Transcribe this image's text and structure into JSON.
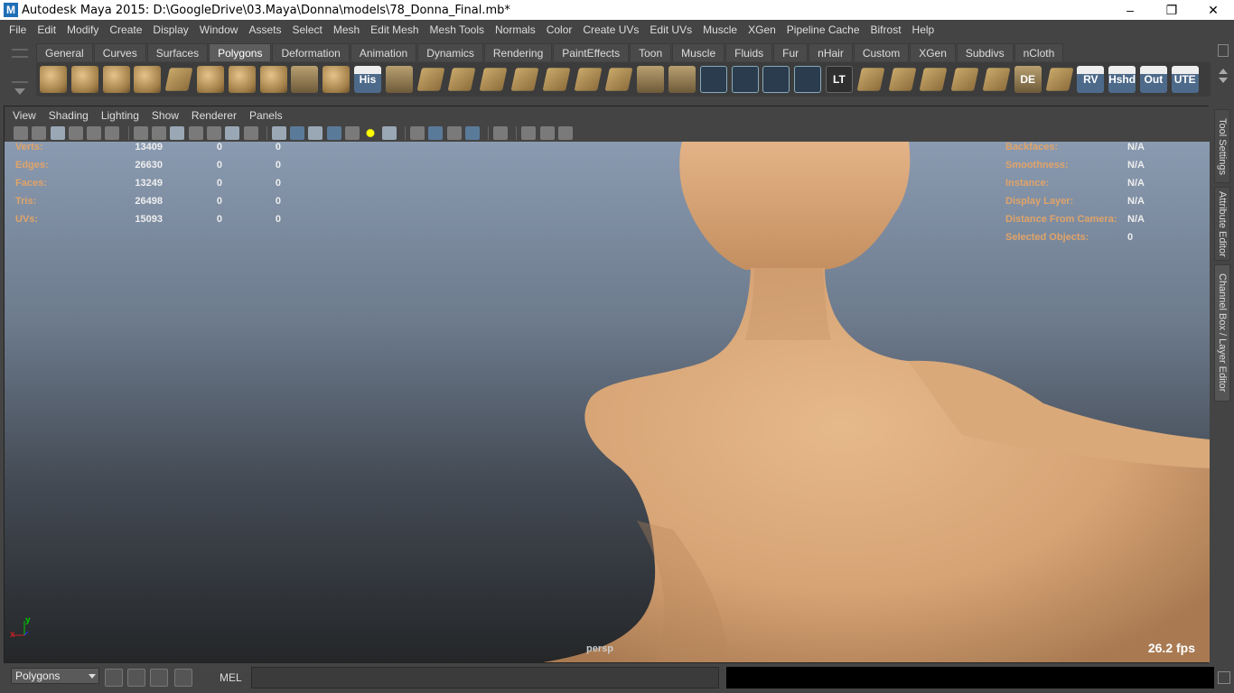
{
  "window": {
    "title": "Autodesk Maya 2015: D:\\GoogleDrive\\03.Maya\\Donna\\models\\78_Donna_Final.mb*",
    "app_icon": "M",
    "minimize": "–",
    "restore": "❐",
    "close": "✕"
  },
  "menubar": [
    "File",
    "Edit",
    "Modify",
    "Create",
    "Display",
    "Window",
    "Assets",
    "Select",
    "Mesh",
    "Edit Mesh",
    "Mesh Tools",
    "Normals",
    "Color",
    "Create UVs",
    "Edit UVs",
    "Muscle",
    "XGen",
    "Pipeline Cache",
    "Bifrost",
    "Help"
  ],
  "shelf": {
    "tabs": [
      "General",
      "Curves",
      "Surfaces",
      "Polygons",
      "Deformation",
      "Animation",
      "Dynamics",
      "Rendering",
      "PaintEffects",
      "Toon",
      "Muscle",
      "Fluids",
      "Fur",
      "nHair",
      "Custom",
      "XGen",
      "Subdivs",
      "nCloth"
    ],
    "active_tab": "Polygons",
    "icons": [
      {
        "name": "poly-sphere-icon",
        "style": "shape",
        "label": ""
      },
      {
        "name": "poly-cube-icon",
        "style": "shape",
        "label": ""
      },
      {
        "name": "poly-cylinder-icon",
        "style": "shape",
        "label": ""
      },
      {
        "name": "poly-cone-icon",
        "style": "shape",
        "label": ""
      },
      {
        "name": "poly-plane-icon",
        "style": "plane",
        "label": ""
      },
      {
        "name": "poly-torus-icon",
        "style": "shape",
        "label": ""
      },
      {
        "name": "poly-pyramid-icon",
        "style": "shape",
        "label": ""
      },
      {
        "name": "poly-pipe-icon",
        "style": "shape",
        "label": ""
      },
      {
        "name": "poly-helix-icon",
        "style": "tool",
        "label": ""
      },
      {
        "name": "poly-soccer-ball-icon",
        "style": "shape",
        "label": ""
      },
      {
        "name": "history-icon",
        "style": "txtw",
        "label": "His"
      },
      {
        "name": "extrude-icon",
        "style": "tool",
        "label": ""
      },
      {
        "name": "split-polygon-icon",
        "style": "plane",
        "label": ""
      },
      {
        "name": "bridge-icon",
        "style": "plane",
        "label": ""
      },
      {
        "name": "bevel-icon",
        "style": "plane",
        "label": ""
      },
      {
        "name": "merge-icon",
        "style": "plane",
        "label": ""
      },
      {
        "name": "append-polygon-icon",
        "style": "plane",
        "label": ""
      },
      {
        "name": "planar-mapping-icon",
        "style": "plane",
        "label": ""
      },
      {
        "name": "smooth-icon",
        "style": "plane",
        "label": ""
      },
      {
        "name": "sculpt-icon",
        "style": "tool",
        "label": ""
      },
      {
        "name": "paint-tool-icon",
        "style": "tool",
        "label": ""
      },
      {
        "name": "wireframe-cube-icon",
        "style": "wire",
        "label": ""
      },
      {
        "name": "target-icon",
        "style": "wire",
        "label": ""
      },
      {
        "name": "manipulator-icon",
        "style": "wire",
        "label": ""
      },
      {
        "name": "transfer-icon",
        "style": "wire",
        "label": ""
      },
      {
        "name": "lt-icon",
        "style": "txt",
        "label": "LT"
      },
      {
        "name": "uv-layout-icon",
        "style": "plane",
        "label": ""
      },
      {
        "name": "uv-cut-icon",
        "style": "plane",
        "label": ""
      },
      {
        "name": "uv-select-icon",
        "style": "plane",
        "label": ""
      },
      {
        "name": "uv-grid-icon",
        "style": "plane",
        "label": ""
      },
      {
        "name": "uv-sew-icon",
        "style": "plane",
        "label": ""
      },
      {
        "name": "de-icon",
        "style": "tool",
        "label": "DE"
      },
      {
        "name": "grid-plane-icon",
        "style": "plane",
        "label": ""
      },
      {
        "name": "rv-icon",
        "style": "txtw",
        "label": "RV"
      },
      {
        "name": "hshd-icon",
        "style": "txtw",
        "label": "Hshd"
      },
      {
        "name": "out-icon",
        "style": "txtw",
        "label": "Out"
      },
      {
        "name": "ute-icon",
        "style": "txtw",
        "label": "UTE"
      }
    ]
  },
  "panel": {
    "menu": [
      "View",
      "Shading",
      "Lighting",
      "Show",
      "Renderer",
      "Panels"
    ],
    "camera": "persp",
    "fps": "26.2 fps"
  },
  "hud_left": [
    {
      "label": "Verts:",
      "v1": "13409",
      "v2": "0",
      "v3": "0"
    },
    {
      "label": "Edges:",
      "v1": "26630",
      "v2": "0",
      "v3": "0"
    },
    {
      "label": "Faces:",
      "v1": "13249",
      "v2": "0",
      "v3": "0"
    },
    {
      "label": "Tris:",
      "v1": "26498",
      "v2": "0",
      "v3": "0"
    },
    {
      "label": "UVs:",
      "v1": "15093",
      "v2": "0",
      "v3": "0"
    }
  ],
  "hud_right": [
    {
      "label": "Backfaces:",
      "value": "N/A"
    },
    {
      "label": "Smoothness:",
      "value": "N/A"
    },
    {
      "label": "Instance:",
      "value": "N/A"
    },
    {
      "label": "Display Layer:",
      "value": "N/A"
    },
    {
      "label": "Distance From Camera:",
      "value": "N/A"
    },
    {
      "label": "Selected Objects:",
      "value": "0"
    }
  ],
  "axis": {
    "x": "x",
    "y": "y"
  },
  "sidetabs": [
    "Tool Settings",
    "Attribute Editor",
    "Channel Box / Layer Editor"
  ],
  "bottombar": {
    "menuset": "Polygons",
    "script_lang": "MEL",
    "command_value": ""
  },
  "colors": {
    "hud_label": "#e0a46a",
    "skin": "#d9a97a",
    "accent_tab": "#5d5d5d"
  }
}
